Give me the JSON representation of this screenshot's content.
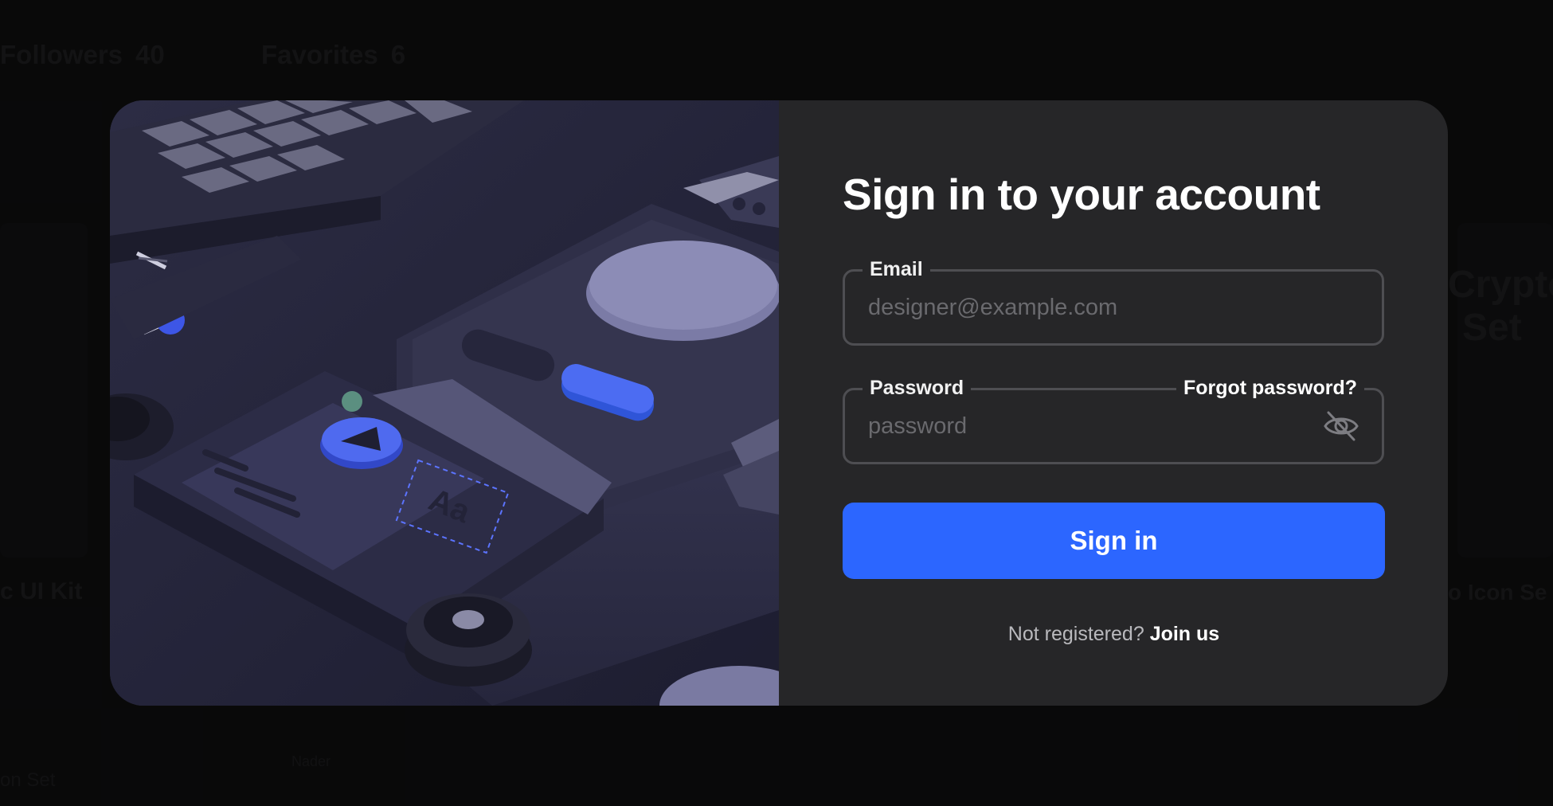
{
  "background": {
    "followers_label": "Followers",
    "followers_count": "40",
    "favorites_label": "Favorites",
    "favorites_count": "6",
    "card_left_title": "c UI Kit",
    "card_right_title_line1": "Crypto",
    "card_right_title_line2": "Set",
    "card_right_subtitle": "o Icon Se",
    "bottom_left_label": "on Set",
    "bottom_mid_label": "Nader"
  },
  "modal": {
    "title": "Sign in to your account",
    "email": {
      "label": "Email",
      "placeholder": "designer@example.com",
      "value": ""
    },
    "password": {
      "label": "Password",
      "placeholder": "password",
      "value": "",
      "forgot_label": "Forgot password?",
      "toggle_icon": "eye-off-icon"
    },
    "submit_label": "Sign in",
    "register_prompt": "Not registered?",
    "register_link": "Join us"
  },
  "colors": {
    "primary": "#2c66ff",
    "modal_bg": "#262628",
    "page_bg": "#111112",
    "field_border": "#4e4e52"
  }
}
